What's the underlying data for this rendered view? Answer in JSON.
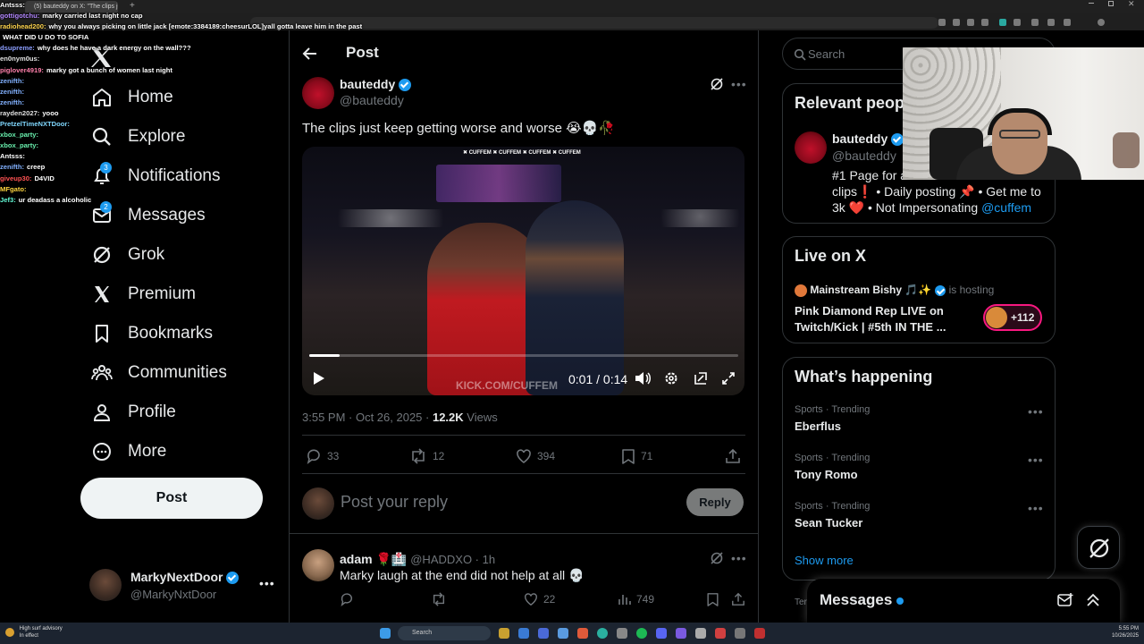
{
  "browser": {
    "tab_title": "(5) bauteddy on X: \"The clips just",
    "address": ""
  },
  "chat": [
    {
      "user": "Antsss:",
      "text": "",
      "color": "#ffffff"
    },
    {
      "user": "gottigotchu:",
      "text": "marky carried last night no cap",
      "color": "#b388ff"
    },
    {
      "user": "radiohead200:",
      "text": "why you always picking on little jack [emote:3384189:cheesurLOL]yall gotta leave him in the past",
      "color": "#ffd54f"
    },
    {
      "user": "",
      "text": "WHAT DID U DO TO SOFIA",
      "color": "#ff5252"
    },
    {
      "user": "dsupreme:",
      "text": "why does he have a dark energy on the wall???",
      "color": "#8c9eff"
    },
    {
      "user": "en0nym0us:",
      "text": "",
      "color": "#e0e0e0"
    },
    {
      "user": "piglover4919:",
      "text": "marky got a bunch of women last night",
      "color": "#ff80ab"
    },
    {
      "user": "zenifth:",
      "text": "",
      "color": "#82b1ff"
    },
    {
      "user": "zenifth:",
      "text": "",
      "color": "#82b1ff"
    },
    {
      "user": "zenifth:",
      "text": "",
      "color": "#82b1ff"
    },
    {
      "user": "rayden2027:",
      "text": "yooo",
      "color": "#e0e0e0"
    },
    {
      "user": "PretzelTimeNXTDoor:",
      "text": "",
      "color": "#80d8ff"
    },
    {
      "user": "xbox_party:",
      "text": "",
      "color": "#69f0ae"
    },
    {
      "user": "xbox_party:",
      "text": "",
      "color": "#69f0ae"
    },
    {
      "user": "Antsss:",
      "text": "",
      "color": "#ffffff"
    },
    {
      "user": "zenifth:",
      "text": "creep",
      "color": "#82b1ff"
    },
    {
      "user": "giveup30:",
      "text": "D4VID",
      "color": "#ff5252"
    },
    {
      "user": "MFgato:",
      "text": "",
      "color": "#ffd740"
    },
    {
      "user": "Jef3:",
      "text": "ur deadass a alcoholic",
      "color": "#64ffda"
    }
  ],
  "nav": {
    "home": "Home",
    "explore": "Explore",
    "notifications": "Notifications",
    "notifications_badge": "3",
    "messages": "Messages",
    "messages_badge": "2",
    "grok": "Grok",
    "premium": "Premium",
    "bookmarks": "Bookmarks",
    "communities": "Communities",
    "profile": "Profile",
    "more": "More",
    "post_button": "Post"
  },
  "account": {
    "name": "MarkyNextDoor",
    "handle": "@MarkyNxtDoor"
  },
  "header": {
    "title": "Post"
  },
  "post": {
    "author_name": "bauteddy",
    "author_handle": "@bauteddy",
    "text": "The clips just keep getting worse and worse 😭💀🥀",
    "video_overlay": "✖ CUFFEM ✖ CUFFEM ✖ CUFFEM ✖ CUFFEM",
    "video_watermark": "KICK.COM/CUFFEM",
    "video_time": "0:01 / 0:14",
    "video_progress": 0.07,
    "timestamp": "3:55 PM · Oct 26, 2025 · ",
    "views_count": "12.2K",
    "views_label": "Views",
    "replies": "33",
    "reposts": "12",
    "likes": "394",
    "bookmarks": "71"
  },
  "reply_box": {
    "placeholder": "Post your reply",
    "button": "Reply"
  },
  "reply": {
    "name": "adam",
    "handle": "@HADDXO · 1h",
    "text": "Marky laugh at the end did not help at all 💀",
    "likes": "22",
    "views": "749"
  },
  "search": {
    "placeholder": "Search"
  },
  "relevant": {
    "title": "Relevant people",
    "name": "bauteddy",
    "handle": "@bauteddy",
    "bio_1": "#1 Page for a",
    "bio_2": "clips❗ • Daily posting 📌 • Get me to",
    "bio_3": "3k ❤️ • Not Impersonating ",
    "bio_link": "@cuffem"
  },
  "live": {
    "title": "Live on X",
    "host": "Mainstream Bishy 🎵✨",
    "hosting": "is hosting",
    "stream_title": "Pink Diamond Rep LIVE on Twitch/Kick | #5th IN THE ...",
    "listeners": "+112"
  },
  "happening": {
    "title": "What’s happening",
    "trends": [
      {
        "category": "Sports · Trending",
        "name": "Eberflus"
      },
      {
        "category": "Sports · Trending",
        "name": "Tony Romo"
      },
      {
        "category": "Sports · Trending",
        "name": "Sean Tucker"
      }
    ],
    "show_more": "Show more",
    "cut_label": "Ter"
  },
  "messages_drawer": {
    "title": "Messages"
  },
  "taskbar": {
    "weather_1": "High surf advisory",
    "weather_2": "In effect",
    "search": "Search",
    "time": "5:55 PM",
    "date": "10/26/2025"
  },
  "colors": {
    "accent": "#1d9bf0",
    "background": "#000000",
    "border": "#2f3336",
    "muted": "#71767b"
  }
}
